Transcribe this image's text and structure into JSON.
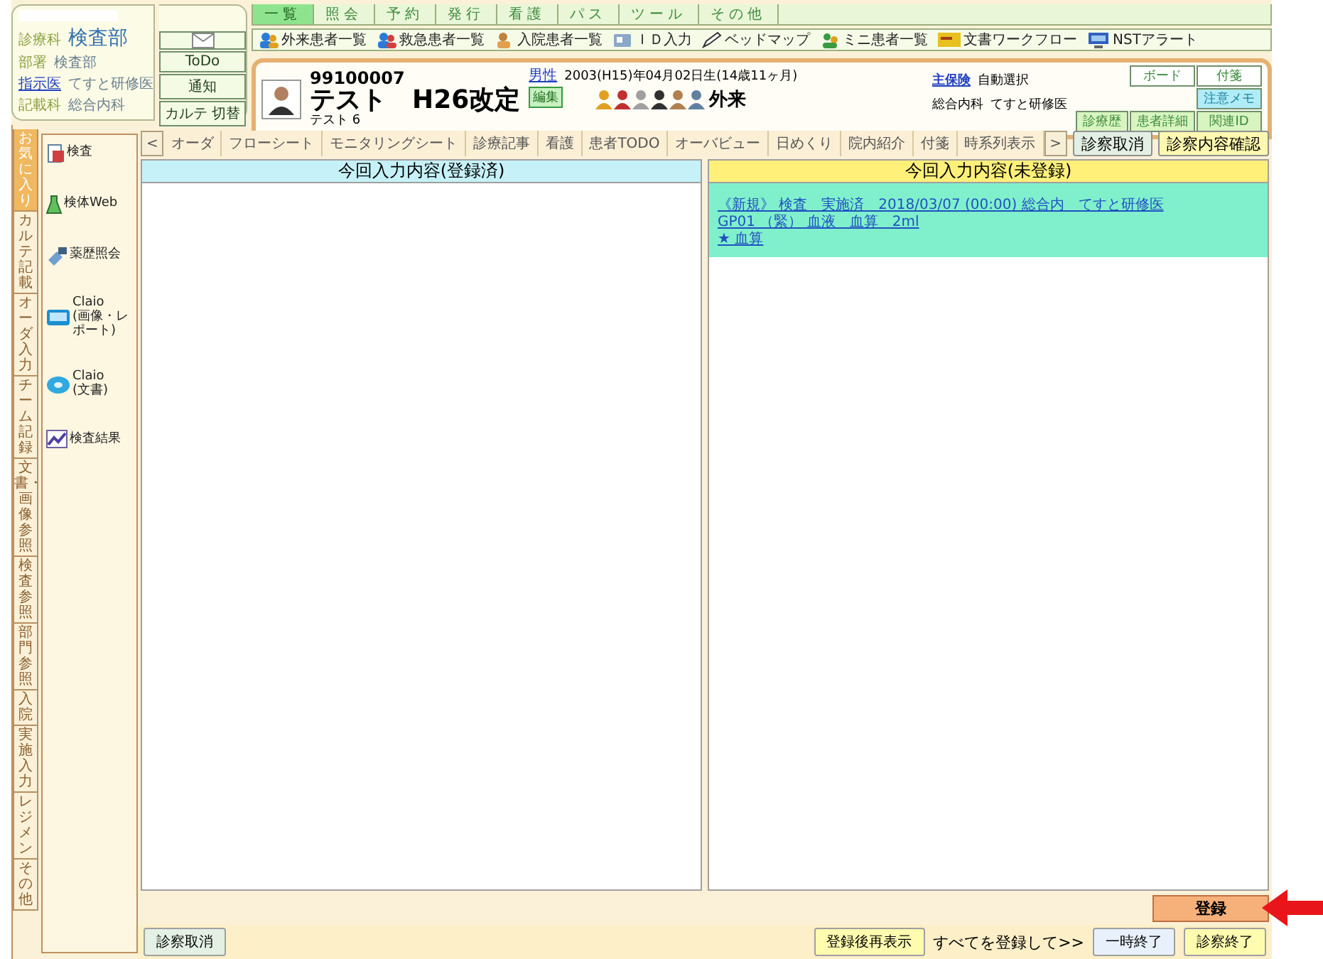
{
  "info": [
    {
      "label": "診療科",
      "value": "検査部",
      "kind": "main"
    },
    {
      "label": "部署",
      "value": "検査部",
      "kind": "plain"
    },
    {
      "label": "指示医",
      "value": "てすと研修医",
      "kind": "link"
    },
    {
      "label": "記載科",
      "value": "総合内科",
      "kind": "plain"
    }
  ],
  "side_buttons": [
    "ToDo",
    "通知",
    "カルテ 切替"
  ],
  "menu_tabs": [
    {
      "label": "一覧",
      "selected": true
    },
    {
      "label": "照会",
      "selected": false
    },
    {
      "label": "予約",
      "selected": false
    },
    {
      "label": "発行",
      "selected": false
    },
    {
      "label": "看護",
      "selected": false
    },
    {
      "label": "パス",
      "selected": false
    },
    {
      "label": "ツール",
      "selected": false
    },
    {
      "label": "その他",
      "selected": false
    }
  ],
  "toolbar": [
    "外来患者一覧",
    "救急患者一覧",
    "入院患者一覧",
    "ＩＤ入力",
    "ベッドマップ",
    "ミニ患者一覧",
    "文書ワークフロー",
    "NSTアラート"
  ],
  "patient": {
    "id": "99100007",
    "name": "テスト　H26改定",
    "kana": "テスト 6",
    "sex": "男性",
    "birth": "2003(H15)年04月02日生(14歳11ヶ月)",
    "edit": "編集",
    "visit": "外来",
    "insurance_label": "主保険",
    "insurance": "自動選択",
    "dept": "総合内科",
    "doctor": "てすと研修医"
  },
  "patient_buttons": [
    "ボード",
    "付箋",
    "注意メモ",
    "診療歴",
    "患者詳細",
    "関連ID"
  ],
  "vertical_tabs": [
    {
      "label": "お気に入り",
      "selected": true
    },
    {
      "label": "カルテ記載",
      "selected": false
    },
    {
      "label": "オーダ入力",
      "selected": false
    },
    {
      "label": "チーム記録",
      "selected": false
    },
    {
      "label": "文書・画像参照",
      "selected": false
    },
    {
      "label": "検査参照",
      "selected": false
    },
    {
      "label": "部門参照",
      "selected": false
    },
    {
      "label": "入院",
      "selected": false
    },
    {
      "label": "実施入力",
      "selected": false
    },
    {
      "label": "レジメン",
      "selected": false
    },
    {
      "label": "その他",
      "selected": false
    }
  ],
  "favorites": [
    {
      "label": "検査"
    },
    {
      "label": "検体Web"
    },
    {
      "label": "薬歴照会"
    },
    {
      "label": "Claio",
      "sub": "(画像・レポート)"
    },
    {
      "label": "Claio",
      "sub": "(文書)"
    },
    {
      "label": "検査結果"
    }
  ],
  "view_nav": {
    "prev": "<",
    "next": ">"
  },
  "view_tabs": [
    "オーダ",
    "フローシート",
    "モニタリングシート",
    "診療記事",
    "看護",
    "患者TODO",
    "オーバビュー",
    "日めくり",
    "院内紹介",
    "付箋",
    "時系列表示"
  ],
  "actions": [
    "診察取消",
    "診察内容確認"
  ],
  "panels": [
    {
      "title": "今回入力内容(登録済)",
      "kind": "registered"
    },
    {
      "title": "今回入力内容(未登録)",
      "kind": "pending",
      "entries": [
        "《新規》 検査　実施済　2018/03/07 (00:00) 総合内　てすと研修医",
        "GP01 （緊） 血液　血算　2ml",
        "★ 血算"
      ]
    }
  ],
  "register_button": "登録",
  "bottom": {
    "cancel": "診察取消",
    "redisplay": "登録後再表示",
    "register_all": "すべてを登録して>>",
    "pause": "一時終了",
    "finish": "診察終了"
  }
}
